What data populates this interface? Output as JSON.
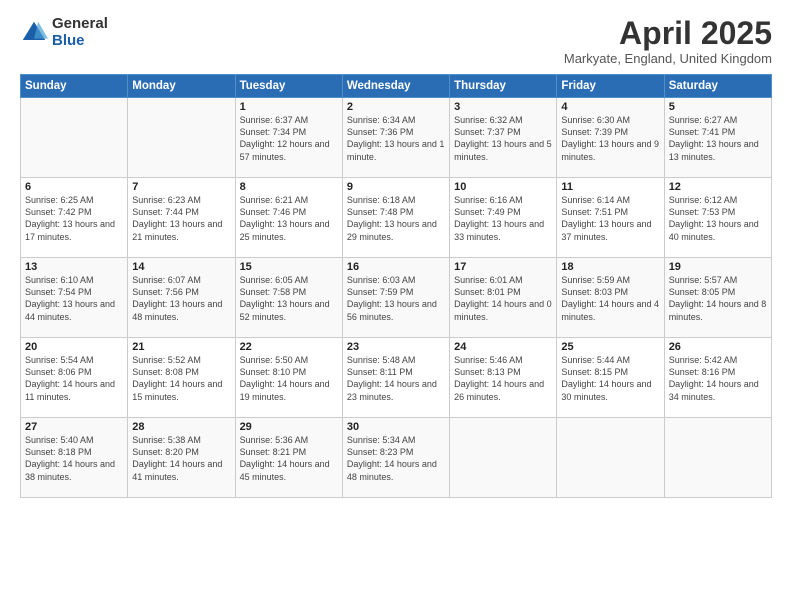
{
  "header": {
    "logo_general": "General",
    "logo_blue": "Blue",
    "title": "April 2025",
    "subtitle": "Markyate, England, United Kingdom"
  },
  "weekdays": [
    "Sunday",
    "Monday",
    "Tuesday",
    "Wednesday",
    "Thursday",
    "Friday",
    "Saturday"
  ],
  "weeks": [
    [
      {
        "day": "",
        "info": ""
      },
      {
        "day": "",
        "info": ""
      },
      {
        "day": "1",
        "info": "Sunrise: 6:37 AM\nSunset: 7:34 PM\nDaylight: 12 hours and 57 minutes."
      },
      {
        "day": "2",
        "info": "Sunrise: 6:34 AM\nSunset: 7:36 PM\nDaylight: 13 hours and 1 minute."
      },
      {
        "day": "3",
        "info": "Sunrise: 6:32 AM\nSunset: 7:37 PM\nDaylight: 13 hours and 5 minutes."
      },
      {
        "day": "4",
        "info": "Sunrise: 6:30 AM\nSunset: 7:39 PM\nDaylight: 13 hours and 9 minutes."
      },
      {
        "day": "5",
        "info": "Sunrise: 6:27 AM\nSunset: 7:41 PM\nDaylight: 13 hours and 13 minutes."
      }
    ],
    [
      {
        "day": "6",
        "info": "Sunrise: 6:25 AM\nSunset: 7:42 PM\nDaylight: 13 hours and 17 minutes."
      },
      {
        "day": "7",
        "info": "Sunrise: 6:23 AM\nSunset: 7:44 PM\nDaylight: 13 hours and 21 minutes."
      },
      {
        "day": "8",
        "info": "Sunrise: 6:21 AM\nSunset: 7:46 PM\nDaylight: 13 hours and 25 minutes."
      },
      {
        "day": "9",
        "info": "Sunrise: 6:18 AM\nSunset: 7:48 PM\nDaylight: 13 hours and 29 minutes."
      },
      {
        "day": "10",
        "info": "Sunrise: 6:16 AM\nSunset: 7:49 PM\nDaylight: 13 hours and 33 minutes."
      },
      {
        "day": "11",
        "info": "Sunrise: 6:14 AM\nSunset: 7:51 PM\nDaylight: 13 hours and 37 minutes."
      },
      {
        "day": "12",
        "info": "Sunrise: 6:12 AM\nSunset: 7:53 PM\nDaylight: 13 hours and 40 minutes."
      }
    ],
    [
      {
        "day": "13",
        "info": "Sunrise: 6:10 AM\nSunset: 7:54 PM\nDaylight: 13 hours and 44 minutes."
      },
      {
        "day": "14",
        "info": "Sunrise: 6:07 AM\nSunset: 7:56 PM\nDaylight: 13 hours and 48 minutes."
      },
      {
        "day": "15",
        "info": "Sunrise: 6:05 AM\nSunset: 7:58 PM\nDaylight: 13 hours and 52 minutes."
      },
      {
        "day": "16",
        "info": "Sunrise: 6:03 AM\nSunset: 7:59 PM\nDaylight: 13 hours and 56 minutes."
      },
      {
        "day": "17",
        "info": "Sunrise: 6:01 AM\nSunset: 8:01 PM\nDaylight: 14 hours and 0 minutes."
      },
      {
        "day": "18",
        "info": "Sunrise: 5:59 AM\nSunset: 8:03 PM\nDaylight: 14 hours and 4 minutes."
      },
      {
        "day": "19",
        "info": "Sunrise: 5:57 AM\nSunset: 8:05 PM\nDaylight: 14 hours and 8 minutes."
      }
    ],
    [
      {
        "day": "20",
        "info": "Sunrise: 5:54 AM\nSunset: 8:06 PM\nDaylight: 14 hours and 11 minutes."
      },
      {
        "day": "21",
        "info": "Sunrise: 5:52 AM\nSunset: 8:08 PM\nDaylight: 14 hours and 15 minutes."
      },
      {
        "day": "22",
        "info": "Sunrise: 5:50 AM\nSunset: 8:10 PM\nDaylight: 14 hours and 19 minutes."
      },
      {
        "day": "23",
        "info": "Sunrise: 5:48 AM\nSunset: 8:11 PM\nDaylight: 14 hours and 23 minutes."
      },
      {
        "day": "24",
        "info": "Sunrise: 5:46 AM\nSunset: 8:13 PM\nDaylight: 14 hours and 26 minutes."
      },
      {
        "day": "25",
        "info": "Sunrise: 5:44 AM\nSunset: 8:15 PM\nDaylight: 14 hours and 30 minutes."
      },
      {
        "day": "26",
        "info": "Sunrise: 5:42 AM\nSunset: 8:16 PM\nDaylight: 14 hours and 34 minutes."
      }
    ],
    [
      {
        "day": "27",
        "info": "Sunrise: 5:40 AM\nSunset: 8:18 PM\nDaylight: 14 hours and 38 minutes."
      },
      {
        "day": "28",
        "info": "Sunrise: 5:38 AM\nSunset: 8:20 PM\nDaylight: 14 hours and 41 minutes."
      },
      {
        "day": "29",
        "info": "Sunrise: 5:36 AM\nSunset: 8:21 PM\nDaylight: 14 hours and 45 minutes."
      },
      {
        "day": "30",
        "info": "Sunrise: 5:34 AM\nSunset: 8:23 PM\nDaylight: 14 hours and 48 minutes."
      },
      {
        "day": "",
        "info": ""
      },
      {
        "day": "",
        "info": ""
      },
      {
        "day": "",
        "info": ""
      }
    ]
  ]
}
